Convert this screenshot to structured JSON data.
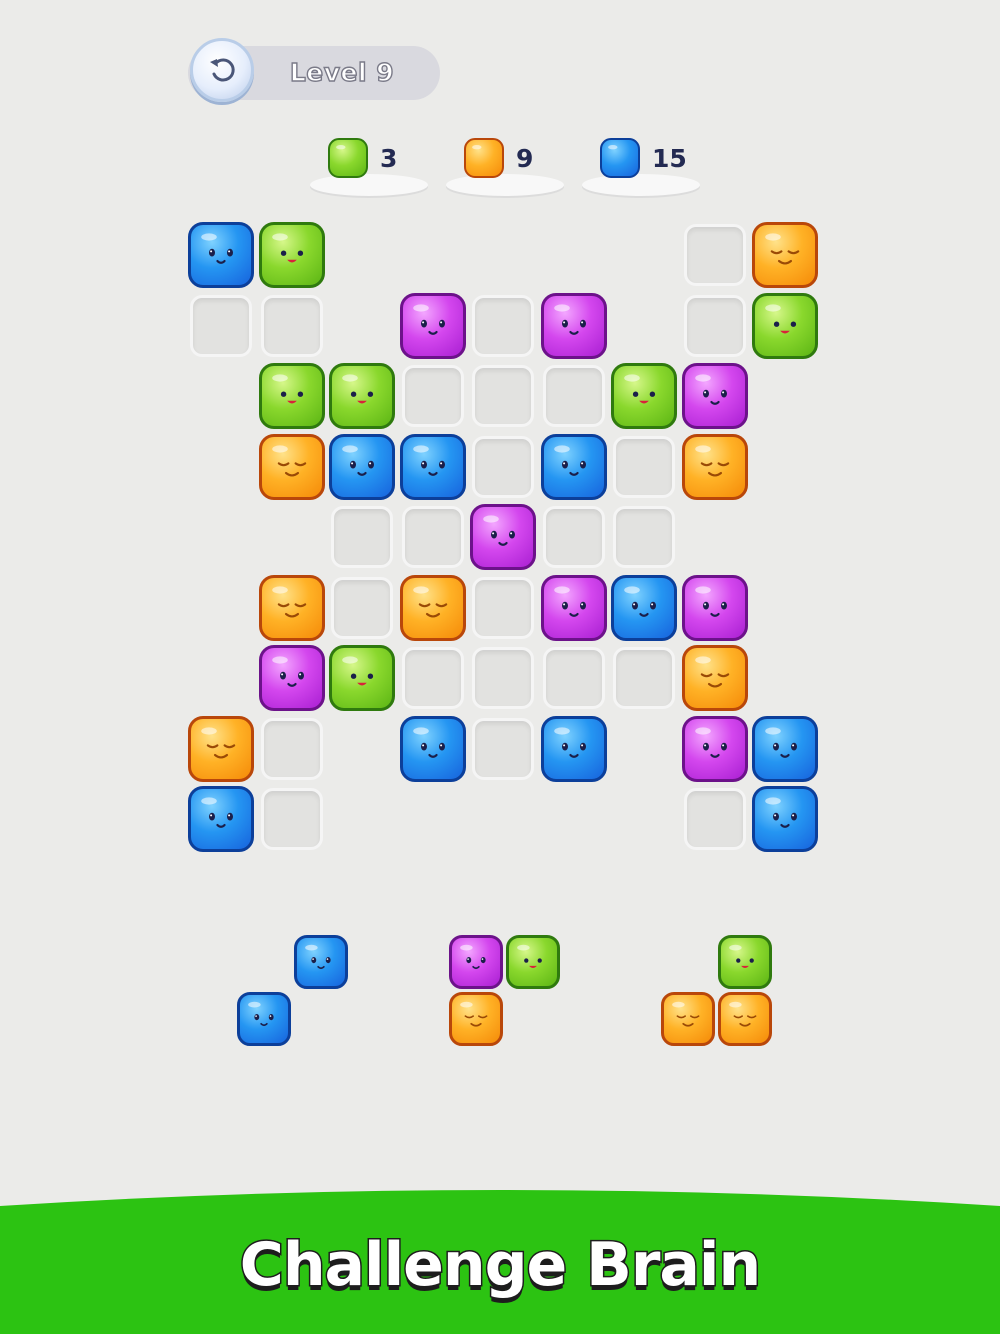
{
  "header": {
    "level_label": "Level 9",
    "restart_icon": "restart-icon"
  },
  "goals": [
    {
      "color": "green",
      "count": "3"
    },
    {
      "color": "orange",
      "count": "9"
    },
    {
      "color": "blue",
      "count": "15"
    }
  ],
  "board": {
    "rows": 9,
    "cols": 9,
    "cells": [
      {
        "r": 0,
        "c": 0,
        "t": "blue"
      },
      {
        "r": 0,
        "c": 1,
        "t": "green"
      },
      {
        "r": 0,
        "c": 7,
        "t": "empty"
      },
      {
        "r": 0,
        "c": 8,
        "t": "orange"
      },
      {
        "r": 1,
        "c": 0,
        "t": "empty"
      },
      {
        "r": 1,
        "c": 1,
        "t": "empty"
      },
      {
        "r": 1,
        "c": 3,
        "t": "purple"
      },
      {
        "r": 1,
        "c": 4,
        "t": "empty"
      },
      {
        "r": 1,
        "c": 5,
        "t": "purple"
      },
      {
        "r": 1,
        "c": 7,
        "t": "empty"
      },
      {
        "r": 1,
        "c": 8,
        "t": "green"
      },
      {
        "r": 2,
        "c": 1,
        "t": "green"
      },
      {
        "r": 2,
        "c": 2,
        "t": "green"
      },
      {
        "r": 2,
        "c": 3,
        "t": "empty"
      },
      {
        "r": 2,
        "c": 4,
        "t": "empty"
      },
      {
        "r": 2,
        "c": 5,
        "t": "empty"
      },
      {
        "r": 2,
        "c": 6,
        "t": "green"
      },
      {
        "r": 2,
        "c": 7,
        "t": "purple"
      },
      {
        "r": 3,
        "c": 1,
        "t": "orange"
      },
      {
        "r": 3,
        "c": 2,
        "t": "blue"
      },
      {
        "r": 3,
        "c": 3,
        "t": "blue"
      },
      {
        "r": 3,
        "c": 4,
        "t": "empty"
      },
      {
        "r": 3,
        "c": 5,
        "t": "blue"
      },
      {
        "r": 3,
        "c": 6,
        "t": "empty"
      },
      {
        "r": 3,
        "c": 7,
        "t": "orange"
      },
      {
        "r": 4,
        "c": 2,
        "t": "empty"
      },
      {
        "r": 4,
        "c": 3,
        "t": "empty"
      },
      {
        "r": 4,
        "c": 4,
        "t": "purple"
      },
      {
        "r": 4,
        "c": 5,
        "t": "empty"
      },
      {
        "r": 4,
        "c": 6,
        "t": "empty"
      },
      {
        "r": 5,
        "c": 1,
        "t": "orange"
      },
      {
        "r": 5,
        "c": 2,
        "t": "empty"
      },
      {
        "r": 5,
        "c": 3,
        "t": "orange"
      },
      {
        "r": 5,
        "c": 4,
        "t": "empty"
      },
      {
        "r": 5,
        "c": 5,
        "t": "purple"
      },
      {
        "r": 5,
        "c": 6,
        "t": "blue"
      },
      {
        "r": 5,
        "c": 7,
        "t": "purple"
      },
      {
        "r": 6,
        "c": 1,
        "t": "purple"
      },
      {
        "r": 6,
        "c": 2,
        "t": "green"
      },
      {
        "r": 6,
        "c": 3,
        "t": "empty"
      },
      {
        "r": 6,
        "c": 4,
        "t": "empty"
      },
      {
        "r": 6,
        "c": 5,
        "t": "empty"
      },
      {
        "r": 6,
        "c": 6,
        "t": "empty"
      },
      {
        "r": 6,
        "c": 7,
        "t": "orange"
      },
      {
        "r": 7,
        "c": 0,
        "t": "orange"
      },
      {
        "r": 7,
        "c": 1,
        "t": "empty"
      },
      {
        "r": 7,
        "c": 3,
        "t": "blue"
      },
      {
        "r": 7,
        "c": 4,
        "t": "empty"
      },
      {
        "r": 7,
        "c": 5,
        "t": "blue"
      },
      {
        "r": 7,
        "c": 7,
        "t": "purple"
      },
      {
        "r": 7,
        "c": 8,
        "t": "blue"
      },
      {
        "r": 8,
        "c": 0,
        "t": "blue"
      },
      {
        "r": 8,
        "c": 1,
        "t": "empty"
      },
      {
        "r": 8,
        "c": 7,
        "t": "empty"
      },
      {
        "r": 8,
        "c": 8,
        "t": "blue"
      }
    ]
  },
  "pieces": [
    {
      "name": "piece-1",
      "blocks": [
        {
          "r": 0,
          "c": 1,
          "t": "blue"
        },
        {
          "r": 1,
          "c": 0,
          "t": "blue"
        }
      ]
    },
    {
      "name": "piece-2",
      "blocks": [
        {
          "r": 0,
          "c": 0,
          "t": "purple"
        },
        {
          "r": 0,
          "c": 1,
          "t": "green"
        },
        {
          "r": 1,
          "c": 0,
          "t": "orange"
        }
      ]
    },
    {
      "name": "piece-3",
      "blocks": [
        {
          "r": 0,
          "c": 1,
          "t": "green"
        },
        {
          "r": 1,
          "c": 0,
          "t": "orange"
        },
        {
          "r": 1,
          "c": 1,
          "t": "orange"
        }
      ]
    }
  ],
  "banner": {
    "text": "Challenge Brain",
    "color": "#2cc312"
  },
  "colors": {
    "blue": "#2596f2",
    "green": "#8ad82d",
    "orange": "#ffb226",
    "purple": "#d447ee"
  }
}
